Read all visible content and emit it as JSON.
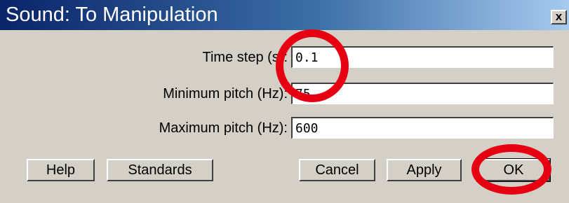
{
  "window": {
    "title": "Sound: To Manipulation",
    "close_label": "x"
  },
  "fields": [
    {
      "label": "Time step (s):",
      "value": "0.1"
    },
    {
      "label": "Minimum pitch (Hz):",
      "value": "75"
    },
    {
      "label": "Maximum pitch (Hz):",
      "value": "600"
    }
  ],
  "buttons": {
    "help": "Help",
    "standards": "Standards",
    "cancel": "Cancel",
    "apply": "Apply",
    "ok": "OK"
  },
  "annotations": {
    "circle_color": "#e60012"
  }
}
